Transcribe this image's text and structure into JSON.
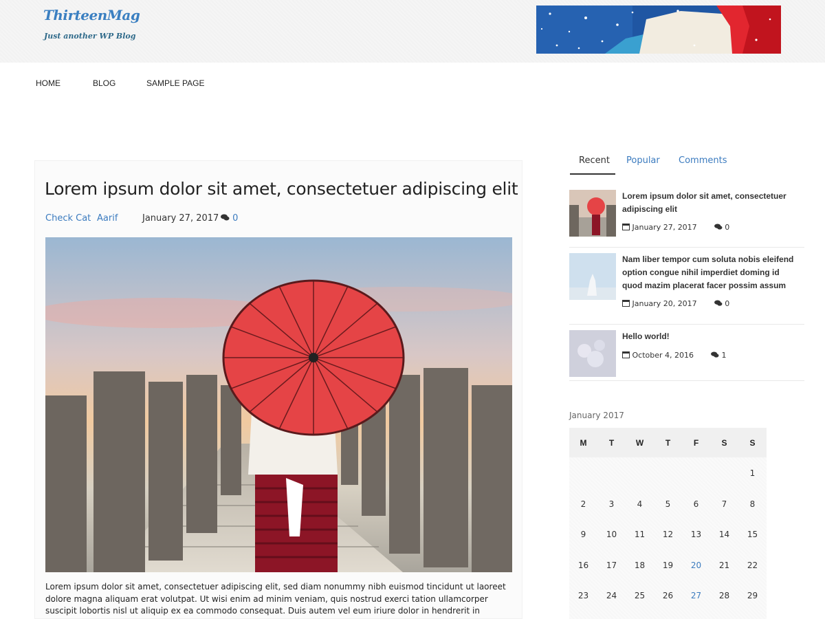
{
  "site": {
    "title": "ThirteenMag",
    "tagline": "Just another WP Blog"
  },
  "nav": {
    "items": [
      {
        "label": "HOME"
      },
      {
        "label": "BLOG"
      },
      {
        "label": "SAMPLE PAGE"
      }
    ]
  },
  "post": {
    "title": "Lorem ipsum dolor sit amet, consectetuer adipiscing elit",
    "category": "Check Cat",
    "author": "Aarif",
    "date": "January 27, 2017",
    "comments": "0",
    "excerpt": "Lorem ipsum dolor sit amet, consectetuer adipiscing elit, sed diam nonummy nibh euismod tincidunt ut laoreet dolore magna aliquam erat volutpat. Ut wisi enim ad minim veniam, quis nostrud exerci tation ullamcorper suscipit lobortis nisl ut aliquip ex ea commodo consequat. Duis autem vel eum iriure dolor in hendrerit in vulputate velit esse"
  },
  "sidebar": {
    "tabs": [
      {
        "label": "Recent"
      },
      {
        "label": "Popular"
      },
      {
        "label": "Comments"
      }
    ],
    "recent": [
      {
        "title": "Lorem ipsum dolor sit amet, consectetuer adipiscing elit",
        "date": "January 27, 2017",
        "comments": "0"
      },
      {
        "title": "Nam liber tempor cum soluta nobis eleifend option congue nihil imperdiet doming id quod mazim placerat facer possim assum",
        "date": "January 20, 2017",
        "comments": "0"
      },
      {
        "title": "Hello world!",
        "date": "October 4, 2016",
        "comments": "1"
      }
    ]
  },
  "calendar": {
    "caption": "January 2017",
    "headers": [
      "M",
      "T",
      "W",
      "T",
      "F",
      "S",
      "S"
    ],
    "rows": [
      [
        "",
        "",
        "",
        "",
        "",
        "",
        "1"
      ],
      [
        "2",
        "3",
        "4",
        "5",
        "6",
        "7",
        "8"
      ],
      [
        "9",
        "10",
        "11",
        "12",
        "13",
        "14",
        "15"
      ],
      [
        "16",
        "17",
        "18",
        "19",
        "20",
        "21",
        "22"
      ],
      [
        "23",
        "24",
        "25",
        "26",
        "27",
        "28",
        "29"
      ]
    ],
    "linked_days": [
      "20",
      "27"
    ]
  },
  "colors": {
    "link": "#3b7bbf",
    "site_title": "#3a7fc1",
    "header_bg": "#f5f5f5"
  }
}
